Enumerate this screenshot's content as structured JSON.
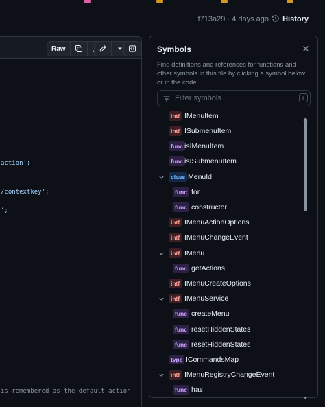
{
  "header": {
    "commit_hash": "f713a29",
    "commit_age": "4 days ago",
    "history_label": "History"
  },
  "toolbar": {
    "raw_label": "Raw",
    "copy_icon": "copy-icon",
    "download_icon": "download-icon",
    "edit_icon": "pencil-icon",
    "more_icon": "chevron-down-icon",
    "symbols_toggle_icon": "symbols-panel-icon"
  },
  "code": {
    "lines": [
      {
        "text": "action';"
      },
      {
        "text": "/contextkey';"
      },
      {
        "text": "';"
      },
      {
        "text": "is remembered as the default action"
      }
    ]
  },
  "symbols": {
    "title": "Symbols",
    "description": "Find definitions and references for functions and other symbols in this file by clicking a symbol below or in the code.",
    "filter_placeholder": "Filter symbols",
    "filter_shortcut": "r",
    "items": [
      {
        "kind": "intf",
        "name": "IMenuItem"
      },
      {
        "kind": "intf",
        "name": "ISubmenuItem"
      },
      {
        "kind": "func",
        "name": "isIMenuItem"
      },
      {
        "kind": "func",
        "name": "isISubmenuItem"
      },
      {
        "kind": "class",
        "name": "MenuId"
      },
      {
        "kind": "func",
        "name": "for"
      },
      {
        "kind": "func",
        "name": "constructor"
      },
      {
        "kind": "intf",
        "name": "IMenuActionOptions"
      },
      {
        "kind": "intf",
        "name": "IMenuChangeEvent"
      },
      {
        "kind": "intf",
        "name": "IMenu"
      },
      {
        "kind": "func",
        "name": "getActions"
      },
      {
        "kind": "intf",
        "name": "IMenuCreateOptions"
      },
      {
        "kind": "intf",
        "name": "IMenuService"
      },
      {
        "kind": "func",
        "name": "createMenu"
      },
      {
        "kind": "func",
        "name": "resetHiddenStates"
      },
      {
        "kind": "func",
        "name": "resetHiddenStates"
      },
      {
        "kind": "type",
        "name": "ICommandsMap"
      },
      {
        "kind": "intf",
        "name": "IMenuRegistryChangeEvent"
      },
      {
        "kind": "func",
        "name": "has"
      }
    ]
  },
  "colors": {
    "background": "#0d1117",
    "border": "#30363d",
    "intf_badge": "#ffa198",
    "func_badge": "#d2a8ff",
    "class_badge": "#79c0ff",
    "string": "#a5d6ff"
  }
}
